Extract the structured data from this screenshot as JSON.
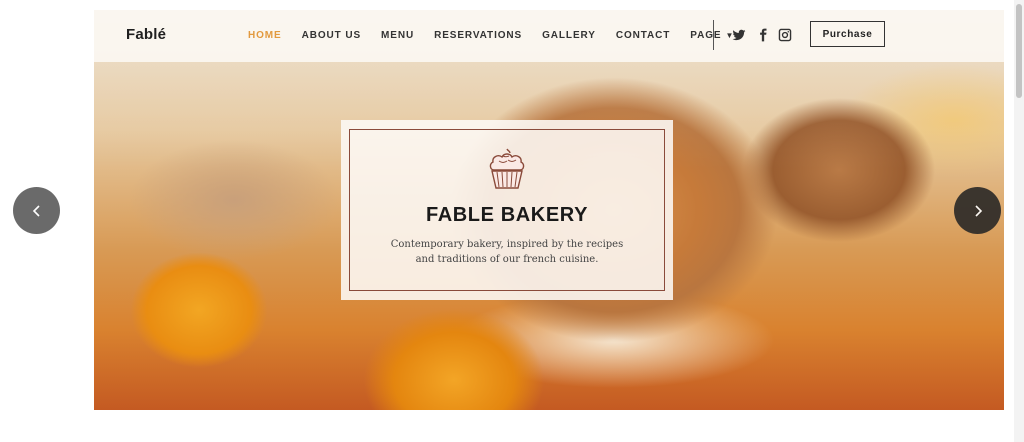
{
  "brand": {
    "logo": "Fablé"
  },
  "nav": {
    "items": [
      {
        "label": "HOME",
        "active": true
      },
      {
        "label": "ABOUT US"
      },
      {
        "label": "MENU"
      },
      {
        "label": "RESERVATIONS"
      },
      {
        "label": "GALLERY"
      },
      {
        "label": "CONTACT"
      },
      {
        "label": "PAGE"
      }
    ],
    "purchase_label": "Purchase"
  },
  "social": [
    "twitter-icon",
    "facebook-icon",
    "instagram-icon"
  ],
  "hero": {
    "title": "FABLE BAKERY",
    "text_line1": "Contemporary bakery, inspired by the recipes",
    "text_line2": "and traditions of our french cuisine."
  },
  "colors": {
    "accent": "#e29a3f",
    "card_border": "#8a4a3a",
    "text_dark": "#1a1a1a"
  }
}
